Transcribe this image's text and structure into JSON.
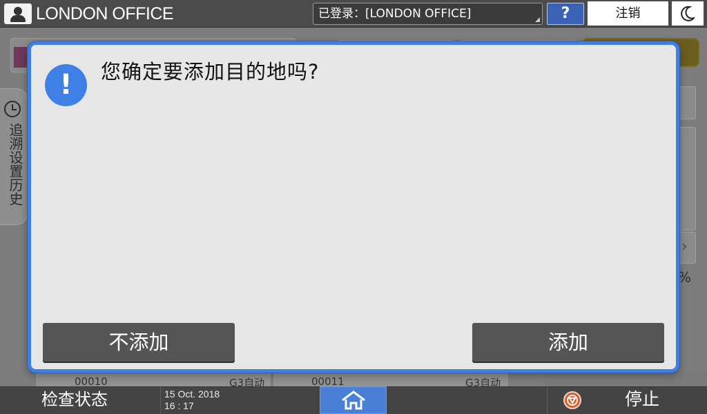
{
  "header": {
    "office_name": "LONDON OFFICE",
    "login_status": "已登录：[LONDON OFFICE]",
    "help_label": "?",
    "logout_label": "注销"
  },
  "background": {
    "history_tab_label": "追溯设置历史",
    "percent_suffix": "%",
    "entries": [
      {
        "number": "00010",
        "mode": "G3自动"
      },
      {
        "number": "00011",
        "mode": "G3自动"
      }
    ]
  },
  "dialog": {
    "icon": "exclamation-icon",
    "icon_glyph": "!",
    "message": "您确定要添加目的地吗?",
    "cancel_label": "不添加",
    "confirm_label": "添加"
  },
  "statusbar": {
    "check_status_label": "检查状态",
    "date": "15 Oct. 2018",
    "time": "16 : 17",
    "stop_label": "停止"
  },
  "colors": {
    "dialog_border": "#3f7fe0",
    "dialog_icon": "#3f80e6",
    "home_button": "#4a7fd6",
    "stop_icon": "#e05a2a",
    "button_bg": "#555555"
  }
}
